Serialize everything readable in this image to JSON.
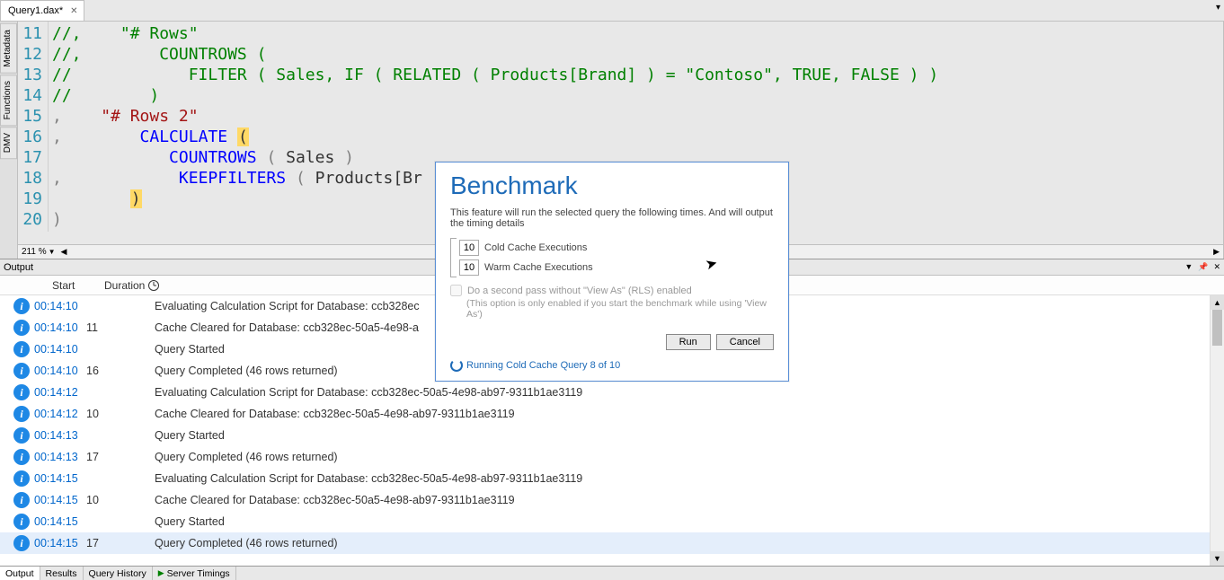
{
  "tab": {
    "title": "Query1.dax*"
  },
  "sideTabs": [
    "Metadata",
    "Functions",
    "DMV"
  ],
  "editor": {
    "zoom": "211 %",
    "lines": [
      {
        "n": 11,
        "html": "<span class='c-comment'>//,    \"# Rows\"</span>"
      },
      {
        "n": 12,
        "html": "<span class='c-comment'>//,        COUNTROWS (</span>"
      },
      {
        "n": 13,
        "html": "<span class='c-comment'>//            FILTER ( Sales, IF ( RELATED ( Products[Brand] ) = \"Contoso\", TRUE, FALSE ) )</span>"
      },
      {
        "n": 14,
        "html": "<span class='c-comment'>//        )</span>"
      },
      {
        "n": 15,
        "html": "<span class='c-punct'>,</span>    <span class='c-string'>\"# Rows 2\"</span>"
      },
      {
        "n": 16,
        "html": "<span class='c-punct'>,</span>        <span class='c-keyword'>CALCULATE</span> <span class='c-brace-hl'>(</span>"
      },
      {
        "n": 17,
        "html": "            <span class='c-keyword'>COUNTROWS</span> <span class='c-punct'>(</span> <span class='c-ident'>Sales</span> <span class='c-punct'>)</span>"
      },
      {
        "n": 18,
        "html": "<span class='c-punct'>,</span>            <span class='c-keyword'>KEEPFILTERS</span> <span class='c-punct'>(</span> <span class='c-ident'>Products[Br</span>"
      },
      {
        "n": 19,
        "html": "        <span class='c-brace-hl'>)</span>"
      },
      {
        "n": 20,
        "html": "<span class='c-punct'>)</span>"
      }
    ]
  },
  "output": {
    "title": "Output",
    "columns": {
      "start": "Start",
      "duration": "Duration"
    },
    "rows": [
      {
        "start": "00:14:10",
        "dur": "",
        "msg": "Evaluating Calculation Script for Database: ccb328ec"
      },
      {
        "start": "00:14:10",
        "dur": "11",
        "msg": "Cache Cleared for Database: ccb328ec-50a5-4e98-a"
      },
      {
        "start": "00:14:10",
        "dur": "",
        "msg": "Query Started"
      },
      {
        "start": "00:14:10",
        "dur": "16",
        "msg": "Query Completed (46 rows returned)"
      },
      {
        "start": "00:14:12",
        "dur": "",
        "msg": "Evaluating Calculation Script for Database: ccb328ec-50a5-4e98-ab97-9311b1ae3119"
      },
      {
        "start": "00:14:12",
        "dur": "10",
        "msg": "Cache Cleared for Database: ccb328ec-50a5-4e98-ab97-9311b1ae3119"
      },
      {
        "start": "00:14:13",
        "dur": "",
        "msg": "Query Started"
      },
      {
        "start": "00:14:13",
        "dur": "17",
        "msg": "Query Completed (46 rows returned)"
      },
      {
        "start": "00:14:15",
        "dur": "",
        "msg": "Evaluating Calculation Script for Database: ccb328ec-50a5-4e98-ab97-9311b1ae3119"
      },
      {
        "start": "00:14:15",
        "dur": "10",
        "msg": "Cache Cleared for Database: ccb328ec-50a5-4e98-ab97-9311b1ae3119"
      },
      {
        "start": "00:14:15",
        "dur": "",
        "msg": "Query Started"
      },
      {
        "start": "00:14:15",
        "dur": "17",
        "msg": "Query Completed (46 rows returned)",
        "sel": true
      }
    ]
  },
  "bottomTabs": {
    "items": [
      "Output",
      "Results",
      "Query History",
      "Server Timings"
    ],
    "active": 0,
    "playPrefixIndex": 3
  },
  "dialog": {
    "title": "Benchmark",
    "desc": "This feature will run the selected query the following times. And will output the timing details",
    "coldValue": "10",
    "coldLabel": "Cold Cache Executions",
    "warmValue": "10",
    "warmLabel": "Warm Cache Executions",
    "secondPass": "Do a second pass without \"View As\" (RLS) enabled",
    "note": "(This option is only enabled if you start the benchmark while using 'View As')",
    "run": "Run",
    "cancel": "Cancel",
    "status": "Running Cold Cache Query 8 of 10"
  }
}
